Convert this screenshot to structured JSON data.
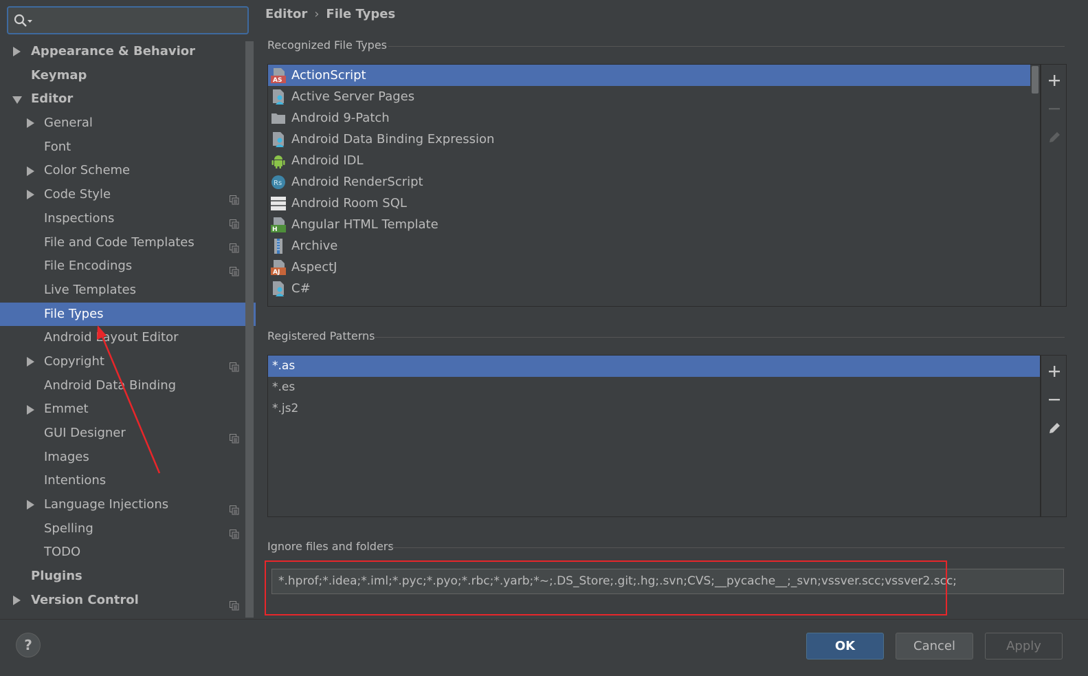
{
  "search": {
    "placeholder": ""
  },
  "sidebar": {
    "items": [
      {
        "label": "Appearance & Behavior",
        "level": 0,
        "expandable": true,
        "expanded": false,
        "bold": true,
        "icon": false
      },
      {
        "label": "Keymap",
        "level": 0,
        "expandable": false,
        "bold": true,
        "icon": false
      },
      {
        "label": "Editor",
        "level": 0,
        "expandable": true,
        "expanded": true,
        "bold": true,
        "icon": false
      },
      {
        "label": "General",
        "level": 1,
        "expandable": true,
        "expanded": false,
        "icon": false
      },
      {
        "label": "Font",
        "level": 1,
        "expandable": false,
        "icon": false
      },
      {
        "label": "Color Scheme",
        "level": 1,
        "expandable": true,
        "expanded": false,
        "icon": false
      },
      {
        "label": "Code Style",
        "level": 1,
        "expandable": true,
        "expanded": false,
        "icon": true
      },
      {
        "label": "Inspections",
        "level": 1,
        "expandable": false,
        "icon": true
      },
      {
        "label": "File and Code Templates",
        "level": 1,
        "expandable": false,
        "icon": true
      },
      {
        "label": "File Encodings",
        "level": 1,
        "expandable": false,
        "icon": true
      },
      {
        "label": "Live Templates",
        "level": 1,
        "expandable": false,
        "icon": false
      },
      {
        "label": "File Types",
        "level": 1,
        "expandable": false,
        "icon": false,
        "selected": true
      },
      {
        "label": "Android Layout Editor",
        "level": 1,
        "expandable": false,
        "icon": false
      },
      {
        "label": "Copyright",
        "level": 1,
        "expandable": true,
        "expanded": false,
        "icon": true
      },
      {
        "label": "Android Data Binding",
        "level": 1,
        "expandable": false,
        "icon": false
      },
      {
        "label": "Emmet",
        "level": 1,
        "expandable": true,
        "expanded": false,
        "icon": false
      },
      {
        "label": "GUI Designer",
        "level": 1,
        "expandable": false,
        "icon": true
      },
      {
        "label": "Images",
        "level": 1,
        "expandable": false,
        "icon": false
      },
      {
        "label": "Intentions",
        "level": 1,
        "expandable": false,
        "icon": false
      },
      {
        "label": "Language Injections",
        "level": 1,
        "expandable": true,
        "expanded": false,
        "icon": true
      },
      {
        "label": "Spelling",
        "level": 1,
        "expandable": false,
        "icon": true
      },
      {
        "label": "TODO",
        "level": 1,
        "expandable": false,
        "icon": false
      },
      {
        "label": "Plugins",
        "level": 0,
        "expandable": false,
        "bold": true,
        "icon": false
      },
      {
        "label": "Version Control",
        "level": 0,
        "expandable": true,
        "expanded": false,
        "bold": true,
        "icon": true
      }
    ]
  },
  "breadcrumb": {
    "parent": "Editor",
    "separator": "›",
    "current": "File Types"
  },
  "recognized": {
    "title": "Recognized File Types",
    "items": [
      {
        "label": "ActionScript",
        "icon": "actionscript-icon",
        "selected": true
      },
      {
        "label": "Active Server Pages",
        "icon": "file-person-icon"
      },
      {
        "label": "Android 9-Patch",
        "icon": "folder-icon"
      },
      {
        "label": "Android Data Binding Expression",
        "icon": "file-person-icon"
      },
      {
        "label": "Android IDL",
        "icon": "android-icon"
      },
      {
        "label": "Android RenderScript",
        "icon": "renderscript-icon"
      },
      {
        "label": "Android Room SQL",
        "icon": "table-icon"
      },
      {
        "label": "Angular HTML Template",
        "icon": "html-icon"
      },
      {
        "label": "Archive",
        "icon": "archive-icon"
      },
      {
        "label": "AspectJ",
        "icon": "aspectj-icon"
      },
      {
        "label": "C#",
        "icon": "file-person-icon"
      }
    ]
  },
  "patterns": {
    "title": "Registered Patterns",
    "items": [
      {
        "label": "*.as",
        "selected": true
      },
      {
        "label": "*.es"
      },
      {
        "label": "*.js2"
      }
    ]
  },
  "ignore": {
    "title": "Ignore files and folders",
    "value": "*.hprof;*.idea;*.iml;*.pyc;*.pyo;*.rbc;*.yarb;*~;.DS_Store;.git;.hg;.svn;CVS;__pycache__;_svn;vssver.scc;vssver2.scc;"
  },
  "footer": {
    "help": "?",
    "ok": "OK",
    "cancel": "Cancel",
    "apply": "Apply"
  },
  "colors": {
    "selection": "#4b6eaf",
    "annotation_red": "#e8262a",
    "primary_button": "#365880"
  }
}
